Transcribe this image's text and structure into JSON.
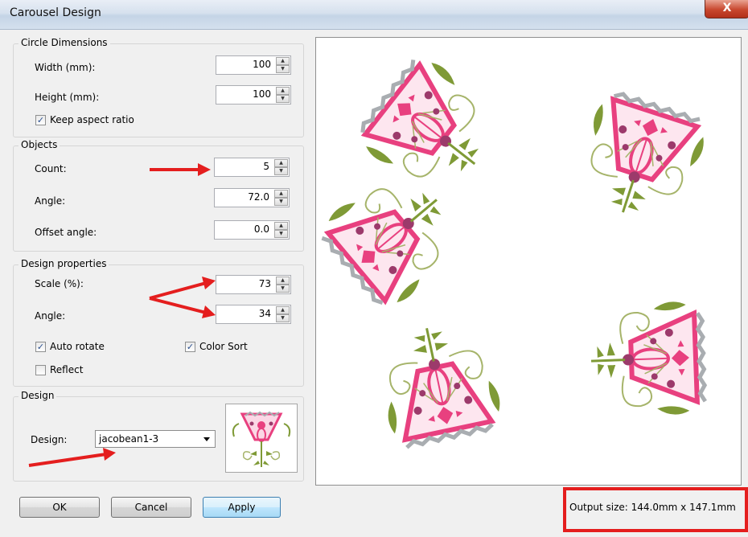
{
  "window": {
    "title": "Carousel Design",
    "close_label": "X"
  },
  "circle_dimensions": {
    "title": "Circle Dimensions",
    "width_label": "Width (mm):",
    "width_value": "100",
    "height_label": "Height (mm):",
    "height_value": "100",
    "keep_aspect_label": "Keep aspect ratio",
    "keep_aspect_checked": true
  },
  "objects": {
    "title": "Objects",
    "count_label": "Count:",
    "count_value": "5",
    "angle_label": "Angle:",
    "angle_value": "72.0",
    "offset_label": "Offset angle:",
    "offset_value": "0.0"
  },
  "design_properties": {
    "title": "Design properties",
    "scale_label": "Scale (%):",
    "scale_value": "73",
    "angle_label": "Angle:",
    "angle_value": "34",
    "auto_rotate_label": "Auto rotate",
    "auto_rotate_checked": true,
    "color_sort_label": "Color Sort",
    "color_sort_checked": true,
    "reflect_label": "Reflect",
    "reflect_checked": false
  },
  "design": {
    "title": "Design",
    "design_label": "Design:",
    "selected": "jacobean1-3"
  },
  "buttons": {
    "ok": "OK",
    "cancel": "Cancel",
    "apply": "Apply"
  },
  "status": {
    "output_size": "Output size: 144.0mm x 147.1mm"
  },
  "colors": {
    "pink": "#e8407f",
    "plum": "#9c3a6b",
    "green": "#7f9a36",
    "gray": "#a9adb1",
    "annotation_red": "#e41e1e"
  },
  "icons": {
    "spin_up": "spin-up-arrow-icon",
    "spin_down": "spin-down-arrow-icon",
    "check": "checkmark-icon",
    "dropdown": "chevron-down-icon"
  }
}
